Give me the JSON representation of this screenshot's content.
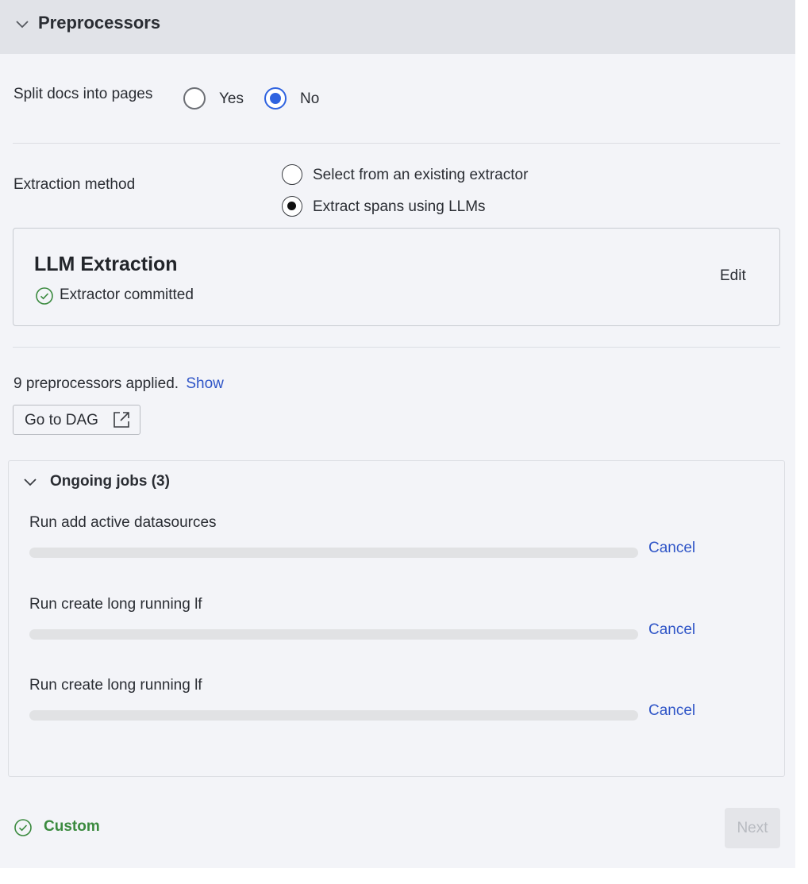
{
  "header": {
    "title": "Preprocessors"
  },
  "split_docs": {
    "label": "Split docs into pages",
    "options": [
      "Yes",
      "No"
    ],
    "selected": "No"
  },
  "extraction": {
    "label": "Extraction method",
    "options": [
      "Select from an existing extractor",
      "Extract spans using LLMs"
    ],
    "selected": "Extract spans using LLMs"
  },
  "llm_card": {
    "title": "LLM Extraction",
    "status": "Extractor committed",
    "edit_label": "Edit",
    "status_color": "#3b8a3f"
  },
  "preprocessors": {
    "summary": "9 preprocessors applied.",
    "show_label": "Show",
    "dag_button": "Go to DAG"
  },
  "jobs": {
    "title": "Ongoing jobs (3)",
    "items": [
      {
        "name": "Run add active datasources",
        "progress": 0,
        "cancel_label": "Cancel"
      },
      {
        "name": "Run create long running lf",
        "progress": 0,
        "cancel_label": "Cancel"
      },
      {
        "name": "Run create long running lf",
        "progress": 0,
        "cancel_label": "Cancel"
      }
    ]
  },
  "footer": {
    "status": "Custom",
    "next_label": "Next"
  },
  "colors": {
    "accent": "#2f63e0",
    "link": "#2f55c7",
    "success": "#3b8a3f"
  }
}
